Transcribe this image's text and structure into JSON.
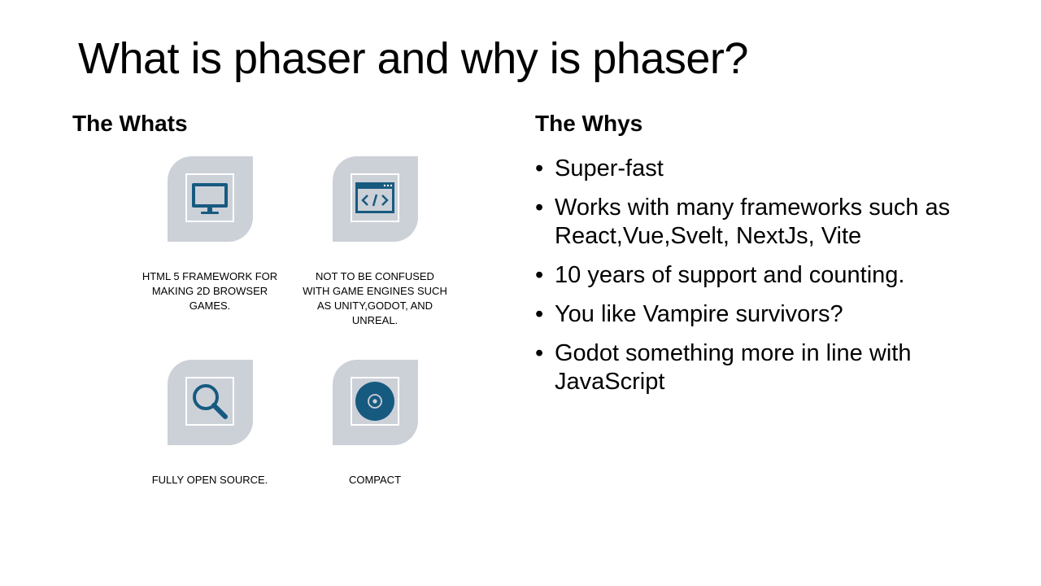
{
  "slide": {
    "title": "What is phaser and why is phaser?"
  },
  "whats": {
    "heading": "The Whats",
    "items": [
      {
        "icon": "monitor-icon",
        "caption": "HTML 5 FRAMEWORK FOR MAKING 2D BROWSER GAMES."
      },
      {
        "icon": "code-window-icon",
        "caption": "NOT TO BE CONFUSED WITH GAME ENGINES SUCH AS UNITY,GODOT, AND UNREAL."
      },
      {
        "icon": "magnifier-icon",
        "caption": "FULLY OPEN SOURCE."
      },
      {
        "icon": "disc-icon",
        "caption": "COMPACT"
      }
    ]
  },
  "whys": {
    "heading": "The Whys",
    "bullet_glyph": "•",
    "items": [
      "Super-fast",
      "Works with many frameworks such as React,Vue,Svelt, NextJs, Vite",
      "10 years of support and counting.",
      "You like Vampire survivors?",
      "Godot something more in line with JavaScript"
    ]
  },
  "colors": {
    "tile": "#ccd1d8",
    "icon": "#175a80",
    "text": "#000000"
  }
}
